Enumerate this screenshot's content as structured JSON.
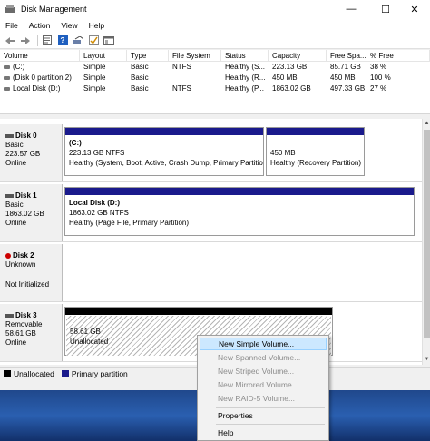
{
  "window": {
    "title": "Disk Management",
    "controls": {
      "minimize": "—",
      "maximize": "☐",
      "close": "✕"
    }
  },
  "menu": [
    "File",
    "Action",
    "View",
    "Help"
  ],
  "toolbar": {
    "buttons": [
      "back-icon",
      "forward-icon",
      "properties-icon",
      "help-icon",
      "rescan-icon",
      "check-icon",
      "console-icon"
    ],
    "help_glyph": "?"
  },
  "volume_list": {
    "columns": [
      "Volume",
      "Layout",
      "Type",
      "File System",
      "Status",
      "Capacity",
      "Free Spa...",
      "% Free"
    ],
    "rows": [
      [
        "(C:)",
        "Simple",
        "Basic",
        "NTFS",
        "Healthy (S...",
        "223.13 GB",
        "85.71 GB",
        "38 %"
      ],
      [
        "(Disk 0 partition 2)",
        "Simple",
        "Basic",
        "",
        "Healthy (R...",
        "450 MB",
        "450 MB",
        "100 %"
      ],
      [
        "Local Disk (D:)",
        "Simple",
        "Basic",
        "NTFS",
        "Healthy (P...",
        "1863.02 GB",
        "497.33 GB",
        "27 %"
      ]
    ]
  },
  "disks": [
    {
      "name": "Disk 0",
      "type": "Basic",
      "size": "223.57 GB",
      "status": "Online",
      "partitions": [
        {
          "label": "(C:)",
          "size": "223.13 GB NTFS",
          "status": "Healthy (System, Boot, Active, Crash Dump, Primary Partitio"
        },
        {
          "label": "",
          "size": "450 MB",
          "status": "Healthy (Recovery Partition)"
        }
      ]
    },
    {
      "name": "Disk 1",
      "type": "Basic",
      "size": "1863.02 GB",
      "status": "Online",
      "partitions": [
        {
          "label": "Local Disk  (D:)",
          "size": "1863.02 GB NTFS",
          "status": "Healthy (Page File, Primary Partition)"
        }
      ]
    },
    {
      "name": "Disk 2",
      "type": "Unknown",
      "size": "",
      "status": "Not Initialized",
      "partitions": []
    },
    {
      "name": "Disk 3",
      "type": "Removable",
      "size": "58.61 GB",
      "status": "Online",
      "partitions": [
        {
          "label": "",
          "size": "58.61 GB",
          "status": "Unallocated"
        }
      ]
    }
  ],
  "legend": [
    {
      "label": "Unallocated",
      "color": "#000000"
    },
    {
      "label": "Primary partition",
      "color": "#1a1a8c"
    }
  ],
  "context_menu": {
    "items": [
      {
        "label": "New Simple Volume...",
        "enabled": true,
        "highlighted": true
      },
      {
        "label": "New Spanned Volume...",
        "enabled": false
      },
      {
        "label": "New Striped Volume...",
        "enabled": false
      },
      {
        "label": "New Mirrored Volume...",
        "enabled": false
      },
      {
        "label": "New RAID-5 Volume...",
        "enabled": false
      },
      {
        "label": "Properties",
        "enabled": true
      },
      {
        "label": "Help",
        "enabled": true
      }
    ]
  }
}
